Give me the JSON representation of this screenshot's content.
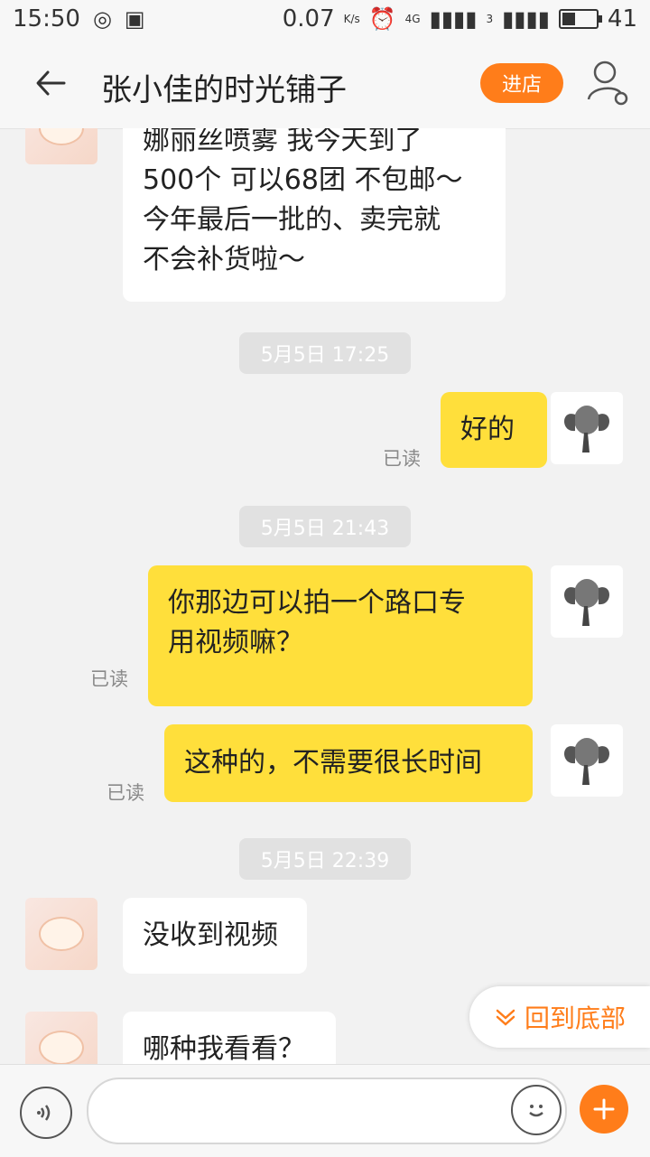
{
  "status_bar": {
    "time": "15:50",
    "speed": "0.07",
    "speed_unit": "K/s",
    "network_label": "4G",
    "sim2_label": "3",
    "battery": "41",
    "battery_fill": 0.41
  },
  "header": {
    "title": "张小佳的时光铺子",
    "enter_store_label": "进店"
  },
  "avatar_labels": {
    "left": "张小佳"
  },
  "messages": [
    {
      "side": "left",
      "lines": [
        "娜丽丝喷雾 我今天到了",
        "500个 可以68团 不包邮～",
        "今年最后一批的、卖完就",
        "不会补货啦～"
      ]
    },
    {
      "type": "time",
      "text": "5月5日 17:25"
    },
    {
      "side": "right",
      "text": "好的",
      "status": "已读"
    },
    {
      "type": "time",
      "text": "5月5日 21:43"
    },
    {
      "side": "right",
      "lines": [
        "你那边可以拍一个路口专",
        "用视频嘛？"
      ],
      "status": "已读"
    },
    {
      "side": "right",
      "text": "这种的，不需要很长时间",
      "status": "已读"
    },
    {
      "type": "time",
      "text": "5月5日 22:39"
    },
    {
      "side": "left",
      "text": "没收到视频"
    },
    {
      "side": "left",
      "text": "哪种我看看？"
    }
  ],
  "back_to_bottom_label": "回到底部",
  "icons": {
    "back": "arrow-left-icon",
    "user_settings": "user-settings-icon",
    "voice": "voice-icon",
    "emoji": "emoji-icon",
    "plus": "plus-icon",
    "chevron": "chevron-down-icon"
  },
  "colors": {
    "accent": "#ff7d1a",
    "bubble_self": "#ffdf3b",
    "bubble_other": "#ffffff",
    "background": "#f2f2f2"
  }
}
